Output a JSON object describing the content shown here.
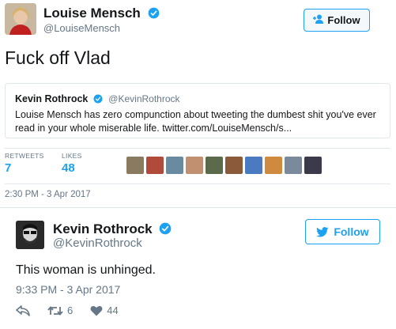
{
  "tweet1": {
    "author_name": "Louise Mensch",
    "author_handle": "@LouiseMensch",
    "follow_label": "Follow",
    "text": "Fuck off Vlad",
    "quote": {
      "author_name": "Kevin Rothrock",
      "author_handle": "@KevinRothrock",
      "text": "Louise Mensch has zero compunction about tweeting the dumbest shit you've ever read in your whole miserable life. twitter.com/LouiseMensch/s..."
    },
    "stats": {
      "retweets_label": "RETWEETS",
      "retweets_value": "7",
      "likes_label": "LIKES",
      "likes_value": "48"
    },
    "timestamp": "2:30 PM - 3 Apr 2017",
    "liker_avatar_colors": [
      "#8a7a60",
      "#b04a3a",
      "#6a8aa0",
      "#c09070",
      "#5a6a4a",
      "#8a5a3a",
      "#4a7ac0",
      "#d08a40",
      "#7a8a9a",
      "#3a3a4a"
    ]
  },
  "tweet2": {
    "author_name": "Kevin Rothrock",
    "author_handle": "@KevinRothrock",
    "follow_label": "Follow",
    "text": "This woman is unhinged.",
    "timestamp": "9:33 PM - 3 Apr 2017",
    "retweet_count": "6",
    "like_count": "44"
  },
  "colors": {
    "accent": "#1da1f2",
    "secondary_text": "#657786",
    "border": "#e1e8ed"
  }
}
